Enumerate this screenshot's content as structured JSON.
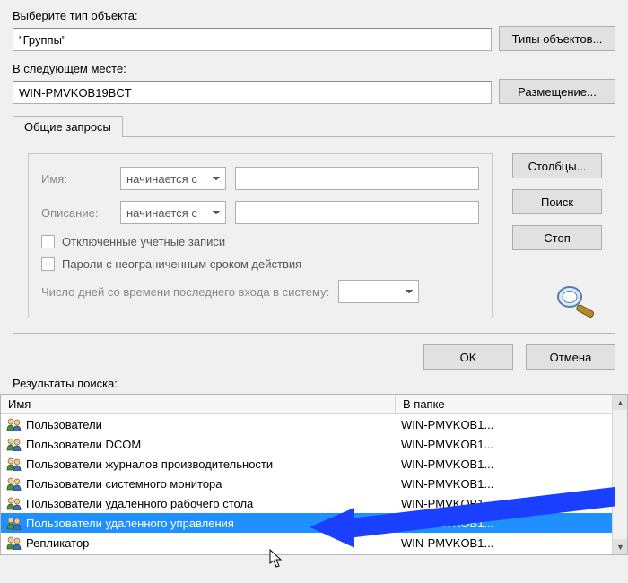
{
  "topLabels": {
    "objectType": "Выберите тип объекта:",
    "location": "В следующем месте:"
  },
  "objectTypeValue": "\"Группы\"",
  "locationValue": "WIN-PMVKOB19BCT",
  "buttons": {
    "objectTypes": "Типы объектов...",
    "locations": "Размещение...",
    "columns": "Столбцы...",
    "search": "Поиск",
    "stop": "Стоп",
    "ok": "OK",
    "cancel": "Отмена"
  },
  "tab": "Общие запросы",
  "query": {
    "nameLabel": "Имя:",
    "descLabel": "Описание:",
    "startsWith": "начинается с",
    "disabledAccounts": "Отключенные учетные записи",
    "nonExpiringPw": "Пароли с неограниченным сроком действия",
    "daysLabel": "Число дней со времени последнего входа в систему:"
  },
  "resultsLabel": "Результаты поиска:",
  "columns": {
    "name": "Имя",
    "folder": "В папке"
  },
  "rows": [
    {
      "name": "Пользователи",
      "folder": "WIN-PMVKOB1..."
    },
    {
      "name": "Пользователи DCOM",
      "folder": "WIN-PMVKOB1..."
    },
    {
      "name": "Пользователи журналов производительности",
      "folder": "WIN-PMVKOB1..."
    },
    {
      "name": "Пользователи системного монитора",
      "folder": "WIN-PMVKOB1..."
    },
    {
      "name": "Пользователи удаленного рабочего стола",
      "folder": "WIN-PMVKOB1..."
    },
    {
      "name": "Пользователи удаленного управления",
      "folder": "WIN-PMVKOB1..."
    },
    {
      "name": "Репликатор",
      "folder": "WIN-PMVKOB1..."
    }
  ],
  "selectedRow": 5
}
